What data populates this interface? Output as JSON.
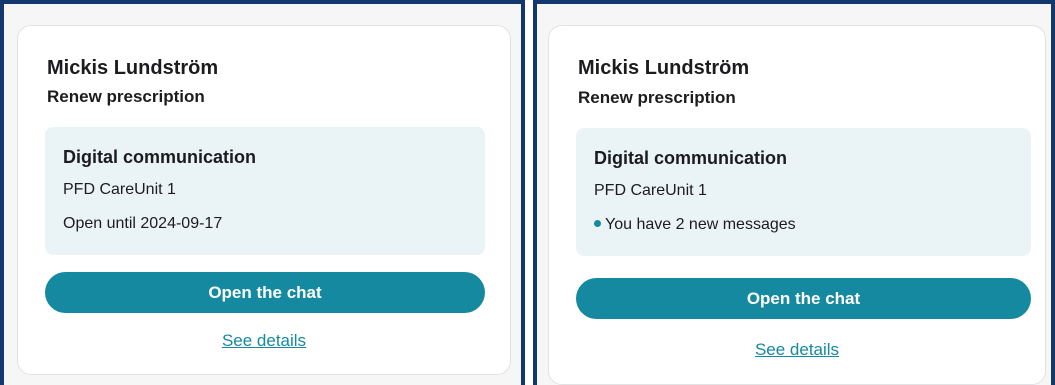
{
  "cards": [
    {
      "name": "Mickis Lundström",
      "subtitle": "Renew prescription",
      "info": {
        "title": "Digital communication",
        "unit": "PFD CareUnit 1",
        "status": "Open until 2024-09-17"
      },
      "button_label": "Open the chat",
      "link_label": "See details"
    },
    {
      "name": "Mickis Lundström",
      "subtitle": "Renew prescription",
      "info": {
        "title": "Digital communication",
        "unit": "PFD CareUnit 1",
        "status": "You have 2 new messages",
        "status_icon": "unread-dot-icon"
      },
      "button_label": "Open the chat",
      "link_label": "See details"
    }
  ],
  "colors": {
    "frame": "#12386e",
    "accent": "#15899f",
    "info_background": "#eaf4f7"
  }
}
